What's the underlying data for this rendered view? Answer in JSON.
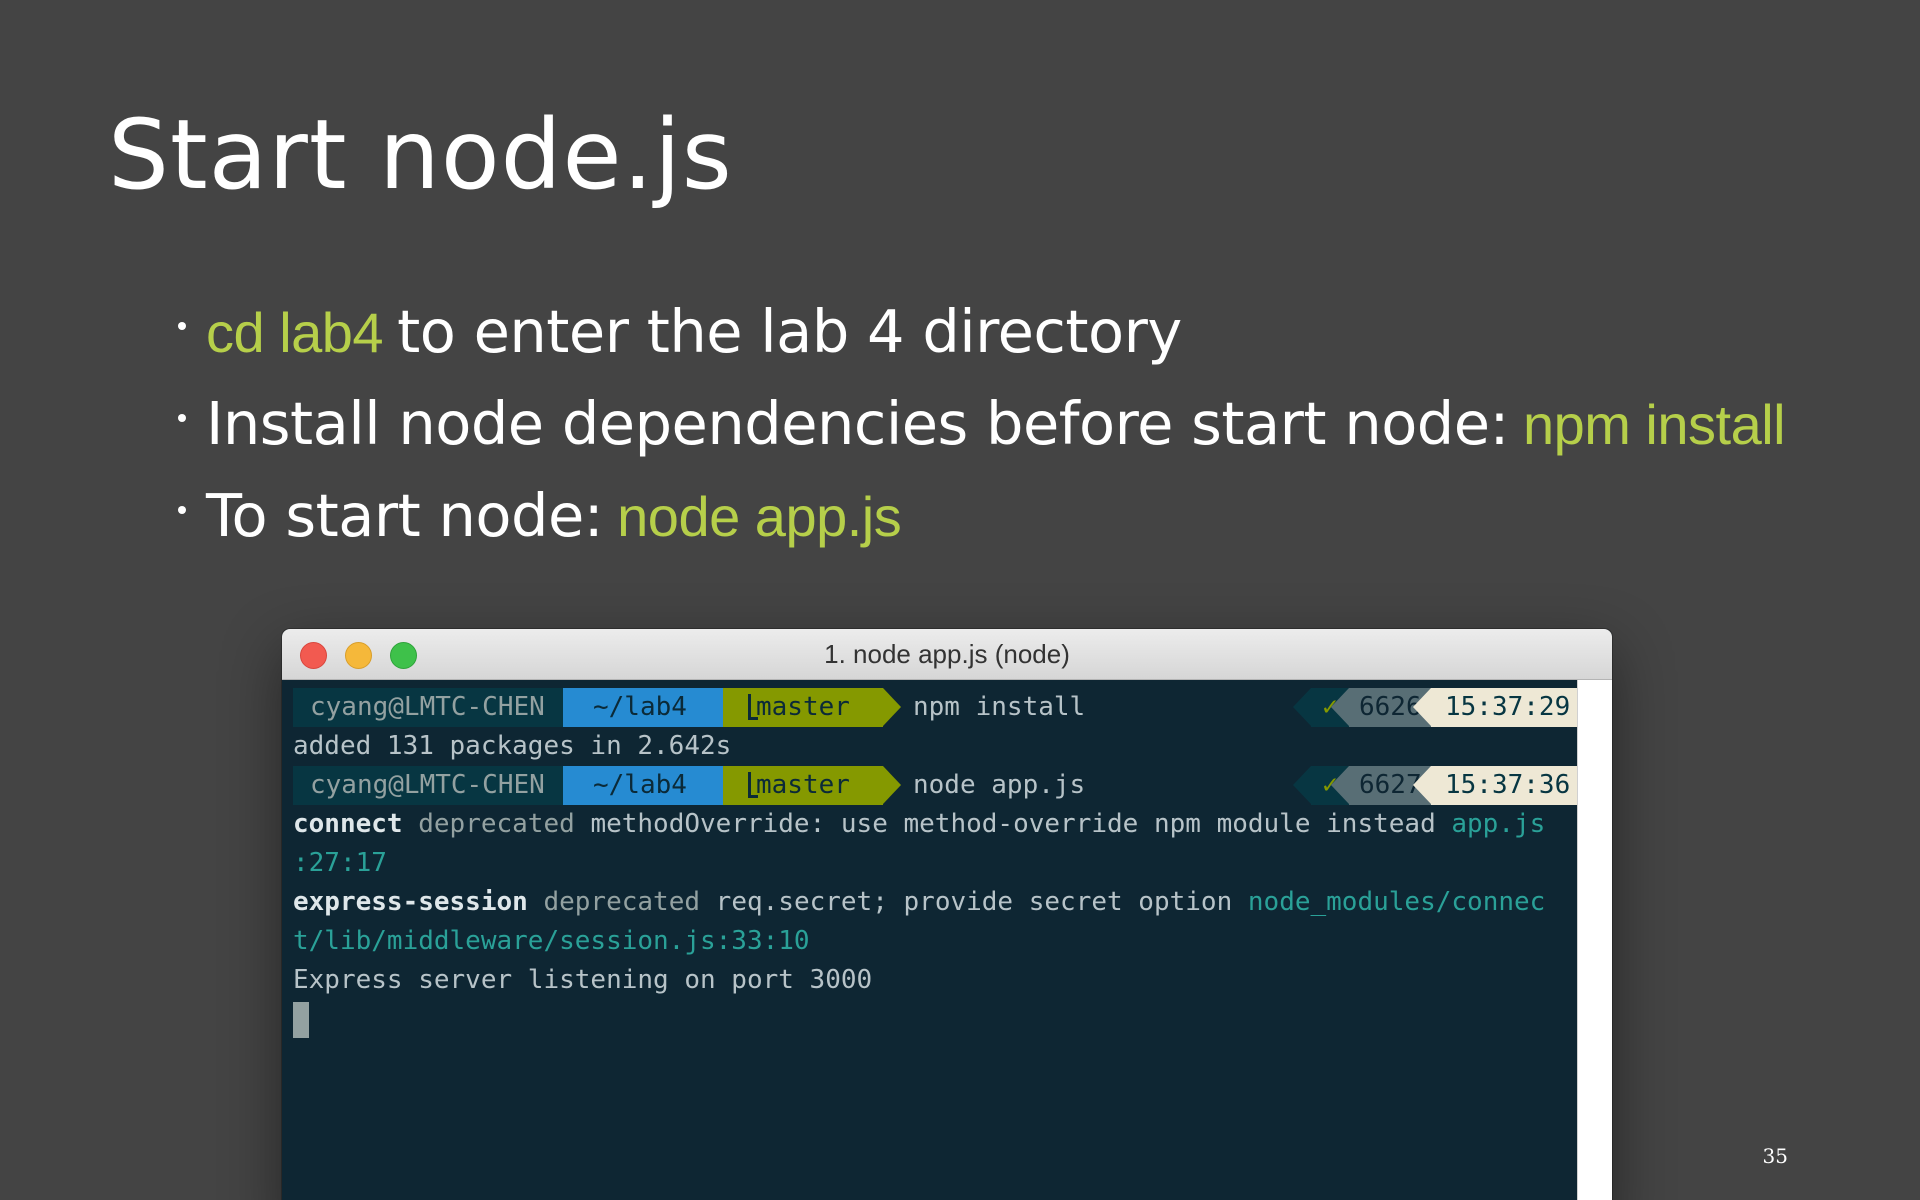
{
  "slide": {
    "title": "Start node.js",
    "page_number": "35",
    "accent_color": "#b6cf4a",
    "bullets": [
      {
        "cmd": "cd lab4",
        "text": "to enter the lab 4 directory"
      },
      {
        "text": "Install node dependencies before start node:",
        "cmd": "npm install"
      },
      {
        "text": "To start node:",
        "cmd": "node app.js"
      }
    ]
  },
  "terminal": {
    "window_title": "1. node app.js (node)",
    "prompts": [
      {
        "user": "cyang@LMTC-CHEN",
        "dir": "~/lab4",
        "branch": "master",
        "command": "npm install",
        "status": "✓",
        "pid": "6626",
        "time": "15:37:29"
      },
      {
        "user": "cyang@LMTC-CHEN",
        "dir": "~/lab4",
        "branch": "master",
        "command": "node app.js",
        "status": "✓",
        "pid": "6627",
        "time": "15:37:36"
      }
    ],
    "npm_output": "added 131 packages in 2.642s",
    "warnings": [
      {
        "module": "connect",
        "label": "deprecated",
        "message": "methodOverride: use method-override npm module instead",
        "location_line1": "app.js",
        "location_line2": ":27:17"
      },
      {
        "module": "express-session",
        "label": "deprecated",
        "message": "req.secret; provide secret option",
        "location_line1": "node_modules/connec",
        "location_line2": "t/lib/middleware/session.js:33:10"
      }
    ],
    "server_output": "Express server listening on port 3000"
  }
}
